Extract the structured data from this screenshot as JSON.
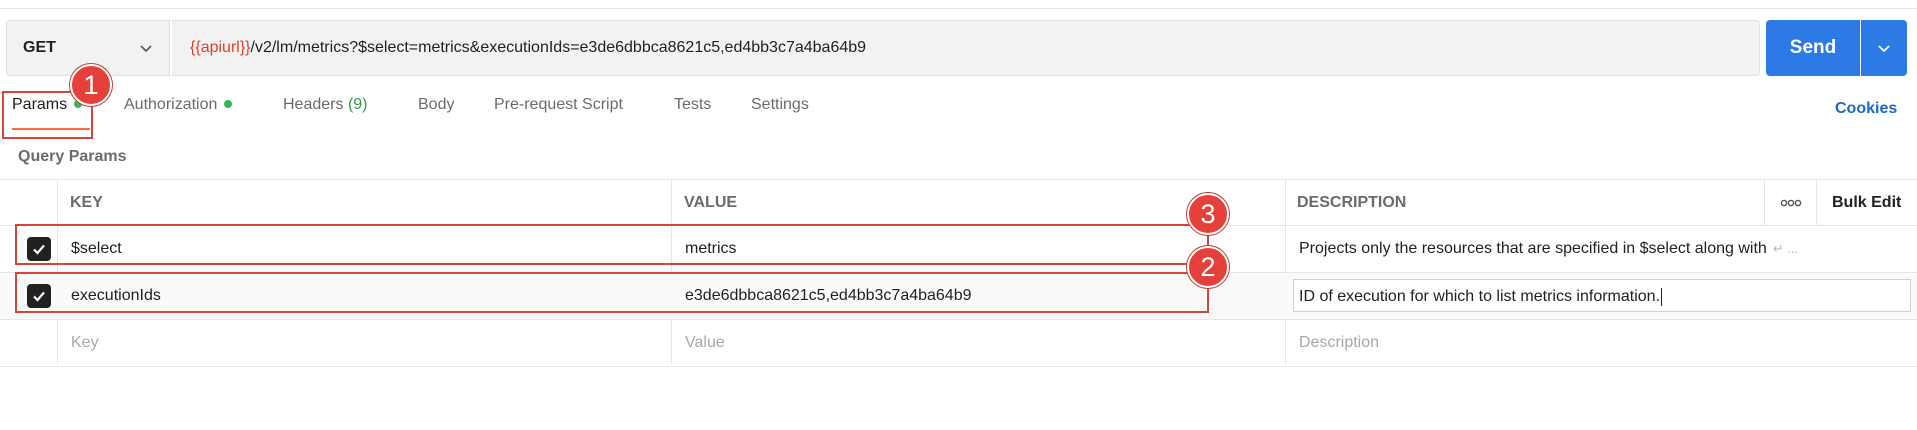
{
  "request": {
    "method": "GET",
    "url_variable": "{{apiurl}}",
    "url_path": "/v2/lm/metrics?$select=metrics&executionIds=e3de6dbbca8621c5,ed4bb3c7a4ba64b9"
  },
  "send_label": "Send",
  "tabs": [
    {
      "label": "Params",
      "has_dot": true
    },
    {
      "label": "Authorization",
      "has_dot": true
    },
    {
      "label": "Headers",
      "count": "(9)"
    },
    {
      "label": "Body"
    },
    {
      "label": "Pre-request Script"
    },
    {
      "label": "Tests"
    },
    {
      "label": "Settings"
    }
  ],
  "cookies_label": "Cookies",
  "query_params_title": "Query Params",
  "table": {
    "headers": {
      "key": "KEY",
      "value": "VALUE",
      "description": "DESCRIPTION",
      "more": "ooo",
      "bulk_edit": "Bulk Edit"
    },
    "rows": [
      {
        "checked": true,
        "key": "$select",
        "value": "metrics",
        "description": "Projects only the resources that are specified in $select along with",
        "description_overflow": "↵ ..."
      },
      {
        "checked": true,
        "key": "executionIds",
        "value": "e3de6dbbca8621c5,ed4bb3c7a4ba64b9",
        "description": "ID of execution for which to list metrics information."
      }
    ],
    "placeholder": {
      "key": "Key",
      "value": "Value",
      "description": "Description"
    }
  },
  "annotations": [
    "1",
    "2",
    "3"
  ],
  "colors": {
    "accent_orange": "#ff6c37",
    "send_blue": "#2b7ae6",
    "annotation_red": "#d9443a",
    "dot_green": "#2fb85a",
    "link_blue": "#1a69c4"
  }
}
